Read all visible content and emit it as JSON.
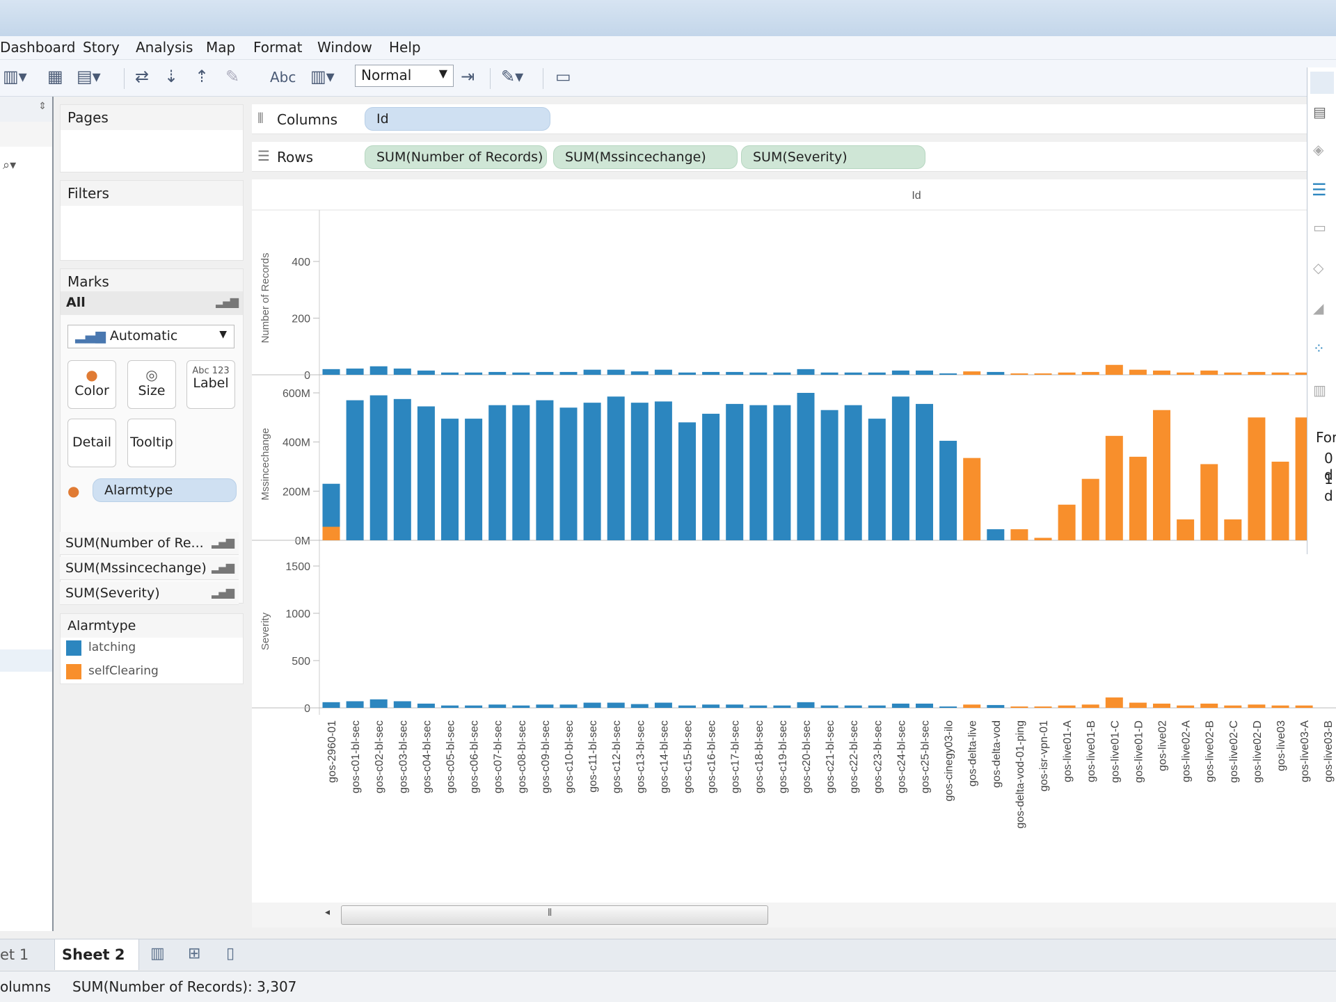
{
  "menu": {
    "items": [
      "Dashboard",
      "Story",
      "Analysis",
      "Map",
      "Format",
      "Window",
      "Help"
    ]
  },
  "toolbar": {
    "zoom_value": "Normal",
    "label_button": "Abc"
  },
  "pages_card": {
    "title": "Pages"
  },
  "filters_card": {
    "title": "Filters"
  },
  "marks_card": {
    "title": "Marks",
    "all_label": "All",
    "mark_type": "Automatic",
    "buttons": {
      "color": "Color",
      "size": "Size",
      "label": "Label",
      "label_icon": "Abc 123",
      "detail": "Detail",
      "tooltip": "Tooltip"
    },
    "color_pill": "Alarmtype",
    "measures": [
      "SUM(Number of Re...",
      "SUM(Mssincechange)",
      "SUM(Severity)"
    ]
  },
  "legend": {
    "title": "Alarmtype",
    "items": [
      {
        "label": "latching",
        "color": "#2c86bf"
      },
      {
        "label": "selfClearing",
        "color": "#f88f2c"
      }
    ]
  },
  "shelves": {
    "columns_label": "Columns",
    "rows_label": "Rows",
    "columns_pills": [
      "Id"
    ],
    "rows_pills": [
      "SUM(Number of Records)",
      "SUM(Mssincechange)",
      "SUM(Severity)"
    ]
  },
  "right_panel": {
    "partial_text": [
      "For",
      "0 d",
      "1 d"
    ]
  },
  "sheet_tabs": [
    "et 1",
    "Sheet 2"
  ],
  "status": {
    "left": "olumns",
    "sum_text": "SUM(Number of Records): 3,307"
  },
  "colors": {
    "latching": "#2c86bf",
    "selfClearing": "#f88f2c",
    "pill_blue": "#cfe0f2",
    "pill_green": "#cfe6d6"
  },
  "chart_data": {
    "type": "bar",
    "header": "Id",
    "categories": [
      "gos-2960-01",
      "gos-c01-bl-sec",
      "gos-c02-bl-sec",
      "gos-c03-bl-sec",
      "gos-c04-bl-sec",
      "gos-c05-bl-sec",
      "gos-c06-bl-sec",
      "gos-c07-bl-sec",
      "gos-c08-bl-sec",
      "gos-c09-bl-sec",
      "gos-c10-bl-sec",
      "gos-c11-bl-sec",
      "gos-c12-bl-sec",
      "gos-c13-bl-sec",
      "gos-c14-bl-sec",
      "gos-c15-bl-sec",
      "gos-c16-bl-sec",
      "gos-c17-bl-sec",
      "gos-c18-bl-sec",
      "gos-c19-bl-sec",
      "gos-c20-bl-sec",
      "gos-c21-bl-sec",
      "gos-c22-bl-sec",
      "gos-c23-bl-sec",
      "gos-c24-bl-sec",
      "gos-c25-bl-sec",
      "gos-cinegy03-ilo",
      "gos-delta-live",
      "gos-delta-vod",
      "gos-delta-vod-01-ping",
      "gos-isr-vpn-01",
      "gos-live01-A",
      "gos-live01-B",
      "gos-live01-C",
      "gos-live01-D",
      "gos-live02",
      "gos-live02-A",
      "gos-live02-B",
      "gos-live02-C",
      "gos-live02-D",
      "gos-live03",
      "gos-live03-A",
      "gos-live03-B"
    ],
    "alarmtype": [
      "latching",
      "latching",
      "latching",
      "latching",
      "latching",
      "latching",
      "latching",
      "latching",
      "latching",
      "latching",
      "latching",
      "latching",
      "latching",
      "latching",
      "latching",
      "latching",
      "latching",
      "latching",
      "latching",
      "latching",
      "latching",
      "latching",
      "latching",
      "latching",
      "latching",
      "latching",
      "latching",
      "selfClearing",
      "latching",
      "selfClearing",
      "selfClearing",
      "selfClearing",
      "selfClearing",
      "selfClearing",
      "selfClearing",
      "selfClearing",
      "selfClearing",
      "selfClearing",
      "selfClearing",
      "selfClearing",
      "selfClearing",
      "selfClearing",
      "selfClearing"
    ],
    "panels": [
      {
        "axis_label": "Number of Records",
        "ylim": [
          0,
          470
        ],
        "ticks": [
          0,
          200,
          400
        ],
        "tick_labels": [
          "0",
          "200",
          "400"
        ],
        "values": [
          20,
          22,
          30,
          22,
          15,
          8,
          8,
          10,
          8,
          10,
          10,
          18,
          18,
          12,
          18,
          8,
          10,
          10,
          8,
          8,
          20,
          8,
          8,
          8,
          15,
          15,
          4,
          12,
          10,
          4,
          4,
          8,
          10,
          35,
          18,
          15,
          8,
          15,
          8,
          10,
          8,
          8
        ],
        "stacked_second": []
      },
      {
        "axis_label": "Mssincechange",
        "ylim": [
          0,
          600000000
        ],
        "ticks": [
          0,
          200000000,
          400000000,
          600000000
        ],
        "tick_labels": [
          "0M",
          "200M",
          "400M",
          "600M"
        ],
        "values": [
          230000000,
          570000000,
          590000000,
          575000000,
          545000000,
          495000000,
          495000000,
          550000000,
          550000000,
          570000000,
          540000000,
          560000000,
          585000000,
          560000000,
          565000000,
          480000000,
          515000000,
          555000000,
          550000000,
          550000000,
          600000000,
          530000000,
          550000000,
          495000000,
          585000000,
          555000000,
          405000000,
          335000000,
          45000000,
          45000000,
          10000000,
          145000000,
          250000000,
          425000000,
          340000000,
          530000000,
          85000000,
          310000000,
          85000000,
          500000000,
          320000000,
          500000000
        ],
        "stacked_base_selfClearing": 55000000
      },
      {
        "axis_label": "Severity",
        "ylim": [
          0,
          1550
        ],
        "ticks": [
          0,
          500,
          1000,
          1500
        ],
        "tick_labels": [
          "0",
          "500",
          "1000",
          "1500"
        ],
        "values": [
          60,
          70,
          90,
          70,
          45,
          25,
          25,
          35,
          25,
          35,
          35,
          55,
          55,
          40,
          55,
          25,
          35,
          35,
          25,
          25,
          60,
          25,
          25,
          25,
          45,
          45,
          10,
          35,
          30,
          10,
          10,
          25,
          35,
          110,
          55,
          45,
          25,
          45,
          25,
          35,
          25,
          25
        ]
      }
    ]
  }
}
